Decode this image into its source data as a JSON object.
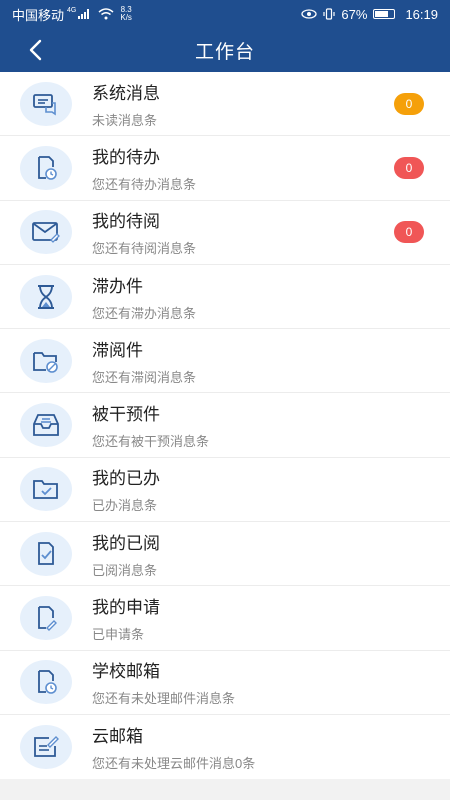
{
  "status_bar": {
    "carrier": "中国移动",
    "network": "4G",
    "speed_value": "8.3",
    "speed_unit": "K/s",
    "battery": "67%",
    "time": "16:19"
  },
  "header": {
    "title": "工作台"
  },
  "colors": {
    "primary": "#1f4e8f",
    "badge_orange": "#f5a00a",
    "badge_red": "#f05656",
    "icon_bg": "#e6f0fb",
    "icon_stroke": "#2e5a96"
  },
  "items": [
    {
      "title": "系统消息",
      "subtitle": "未读消息条",
      "icon": "message-icon",
      "badge": "0",
      "badge_color": "#f5a00a"
    },
    {
      "title": "我的待办",
      "subtitle": "您还有待办消息条",
      "icon": "document-clock-icon",
      "badge": "0",
      "badge_color": "#f05656"
    },
    {
      "title": "我的待阅",
      "subtitle": "您还有待阅消息条",
      "icon": "mail-edit-icon",
      "badge": "0",
      "badge_color": "#f05656"
    },
    {
      "title": "滞办件",
      "subtitle": "您还有滞办消息条",
      "icon": "hourglass-icon"
    },
    {
      "title": "滞阅件",
      "subtitle": "您还有滞阅消息条",
      "icon": "folder-clock-icon"
    },
    {
      "title": "被干预件",
      "subtitle": "您还有被干预消息条",
      "icon": "inbox-icon"
    },
    {
      "title": "我的已办",
      "subtitle": "已办消息条",
      "icon": "folder-check-icon"
    },
    {
      "title": "我的已阅",
      "subtitle": "已阅消息条",
      "icon": "document-check-icon"
    },
    {
      "title": "我的申请",
      "subtitle": "已申请条",
      "icon": "document-edit-icon"
    },
    {
      "title": "学校邮箱",
      "subtitle": "您还有未处理邮件消息条",
      "icon": "document-clock-icon"
    },
    {
      "title": "云邮箱",
      "subtitle": "您还有未处理云邮件消息0条",
      "icon": "edit-box-icon"
    }
  ]
}
